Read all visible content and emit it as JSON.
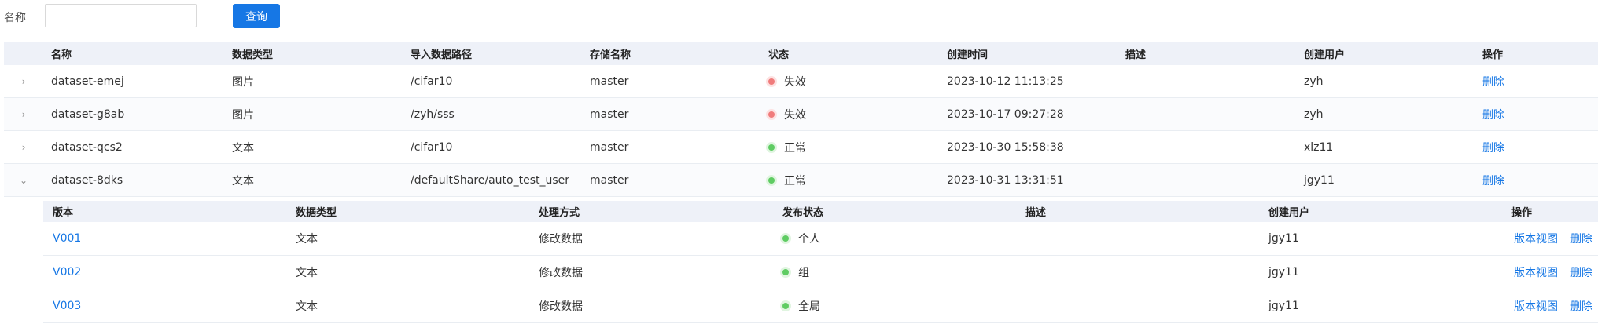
{
  "search": {
    "label": "名称",
    "value": "",
    "placeholder": "",
    "button": "查询"
  },
  "table": {
    "columns": [
      "名称",
      "数据类型",
      "导入数据路径",
      "存储名称",
      "状态",
      "创建时间",
      "描述",
      "创建用户",
      "操作"
    ],
    "rows": [
      {
        "name": "dataset-emej",
        "type": "图片",
        "path": "/cifar10",
        "storage": "master",
        "status": "失效",
        "status_color": "#f07c7c",
        "created": "2023-10-12 11:13:25",
        "desc": "",
        "user": "zyh",
        "action": "删除",
        "expanded": false
      },
      {
        "name": "dataset-g8ab",
        "type": "图片",
        "path": "/zyh/sss",
        "storage": "master",
        "status": "失效",
        "status_color": "#f07c7c",
        "created": "2023-10-17 09:27:28",
        "desc": "",
        "user": "zyh",
        "action": "删除",
        "expanded": false
      },
      {
        "name": "dataset-qcs2",
        "type": "文本",
        "path": "/cifar10",
        "storage": "master",
        "status": "正常",
        "status_color": "#5fcc63",
        "created": "2023-10-30 15:58:38",
        "desc": "",
        "user": "xlz11",
        "action": "删除",
        "expanded": false
      },
      {
        "name": "dataset-8dks",
        "type": "文本",
        "path": "/defaultShare/auto_test_user",
        "storage": "master",
        "status": "正常",
        "status_color": "#5fcc63",
        "created": "2023-10-31 13:31:51",
        "desc": "",
        "user": "jgy11",
        "action": "删除",
        "expanded": true
      }
    ]
  },
  "subtable": {
    "columns": [
      "版本",
      "数据类型",
      "处理方式",
      "发布状态",
      "描述",
      "创建用户",
      "操作"
    ],
    "rows": [
      {
        "version": "V001",
        "type": "文本",
        "method": "修改数据",
        "publish": "个人",
        "desc": "",
        "user": "jgy11",
        "view": "版本视图",
        "delete": "删除"
      },
      {
        "version": "V002",
        "type": "文本",
        "method": "修改数据",
        "publish": "组",
        "desc": "",
        "user": "jgy11",
        "view": "版本视图",
        "delete": "删除"
      },
      {
        "version": "V003",
        "type": "文本",
        "method": "修改数据",
        "publish": "全局",
        "desc": "",
        "user": "jgy11",
        "view": "版本视图",
        "delete": "删除"
      }
    ]
  }
}
